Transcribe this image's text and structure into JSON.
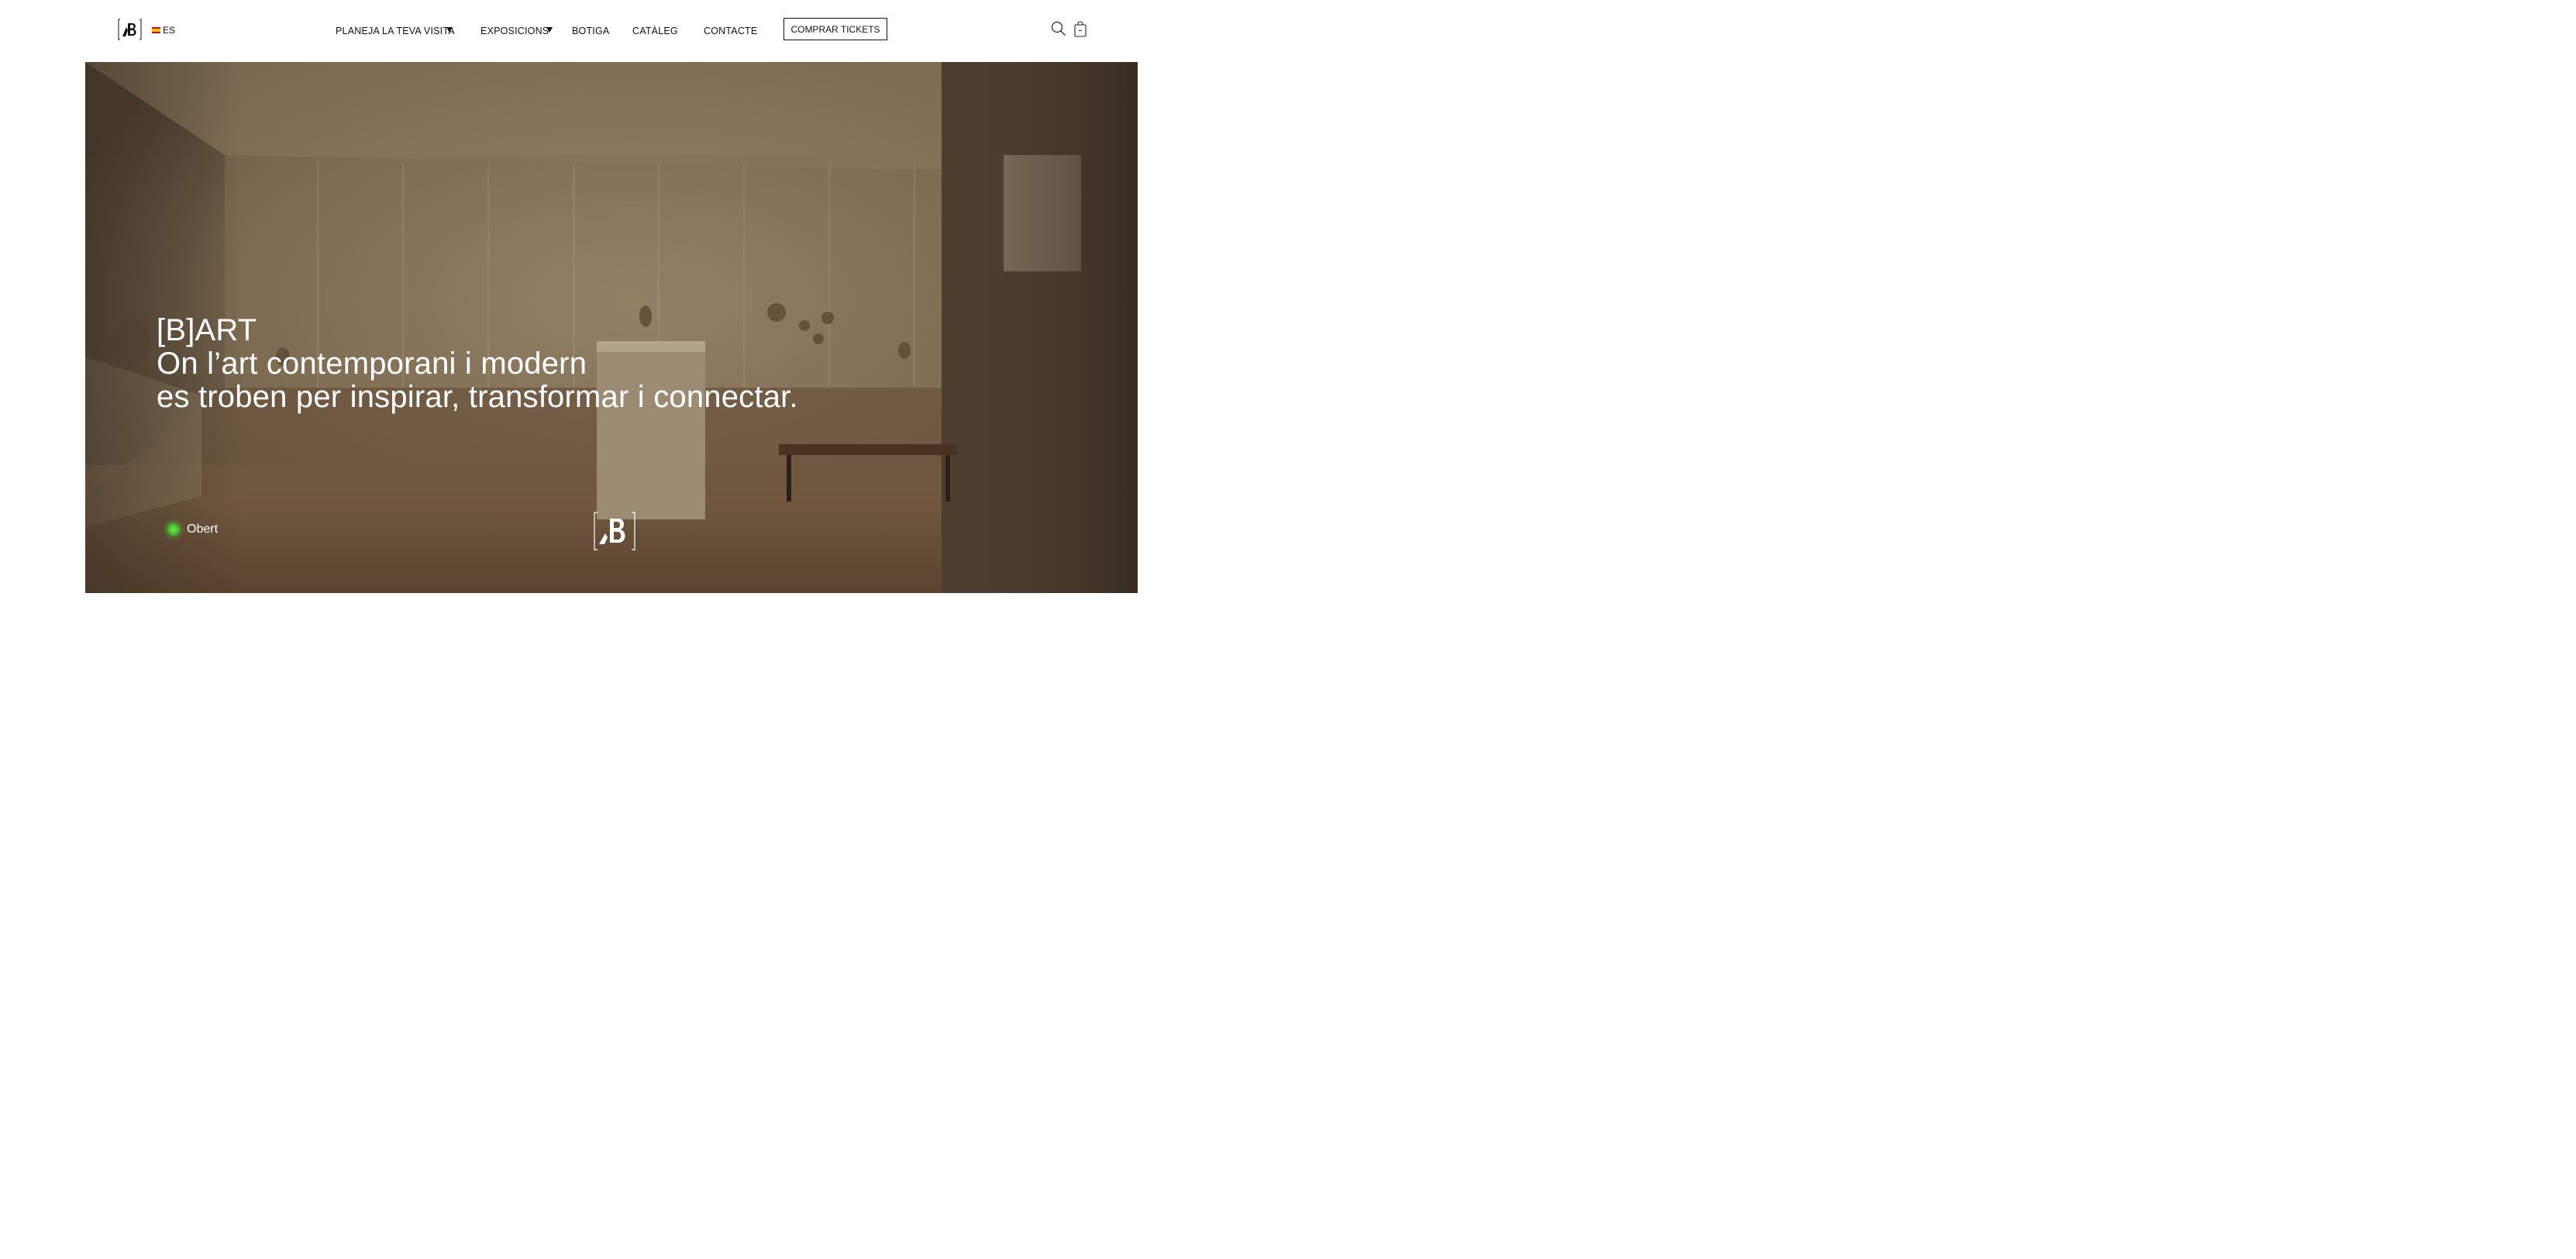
{
  "header": {
    "language": "ES",
    "nav": {
      "plan_visit": "PLANEJA LA TEVA VISITA",
      "exhibitions": "EXPOSICIONS",
      "shop": "BOTIGA",
      "catalog": "CATÀLEG",
      "contact": "CONTACTE"
    },
    "buy_tickets": "COMPRAR TICKETS",
    "icons": [
      "brand-logo-icon",
      "spain-flag-icon",
      "chevron-down-icon",
      "search-icon",
      "shopping-bag-icon"
    ]
  },
  "hero": {
    "line1": "[B]ART",
    "line2": "On l’art contemporani i modern",
    "line3": "es troben per inspirar, transformar i connectar.",
    "status_label": "Obert",
    "colors": {
      "status_dot": "#3fbf2a",
      "overlay": "#6b5a45"
    }
  }
}
